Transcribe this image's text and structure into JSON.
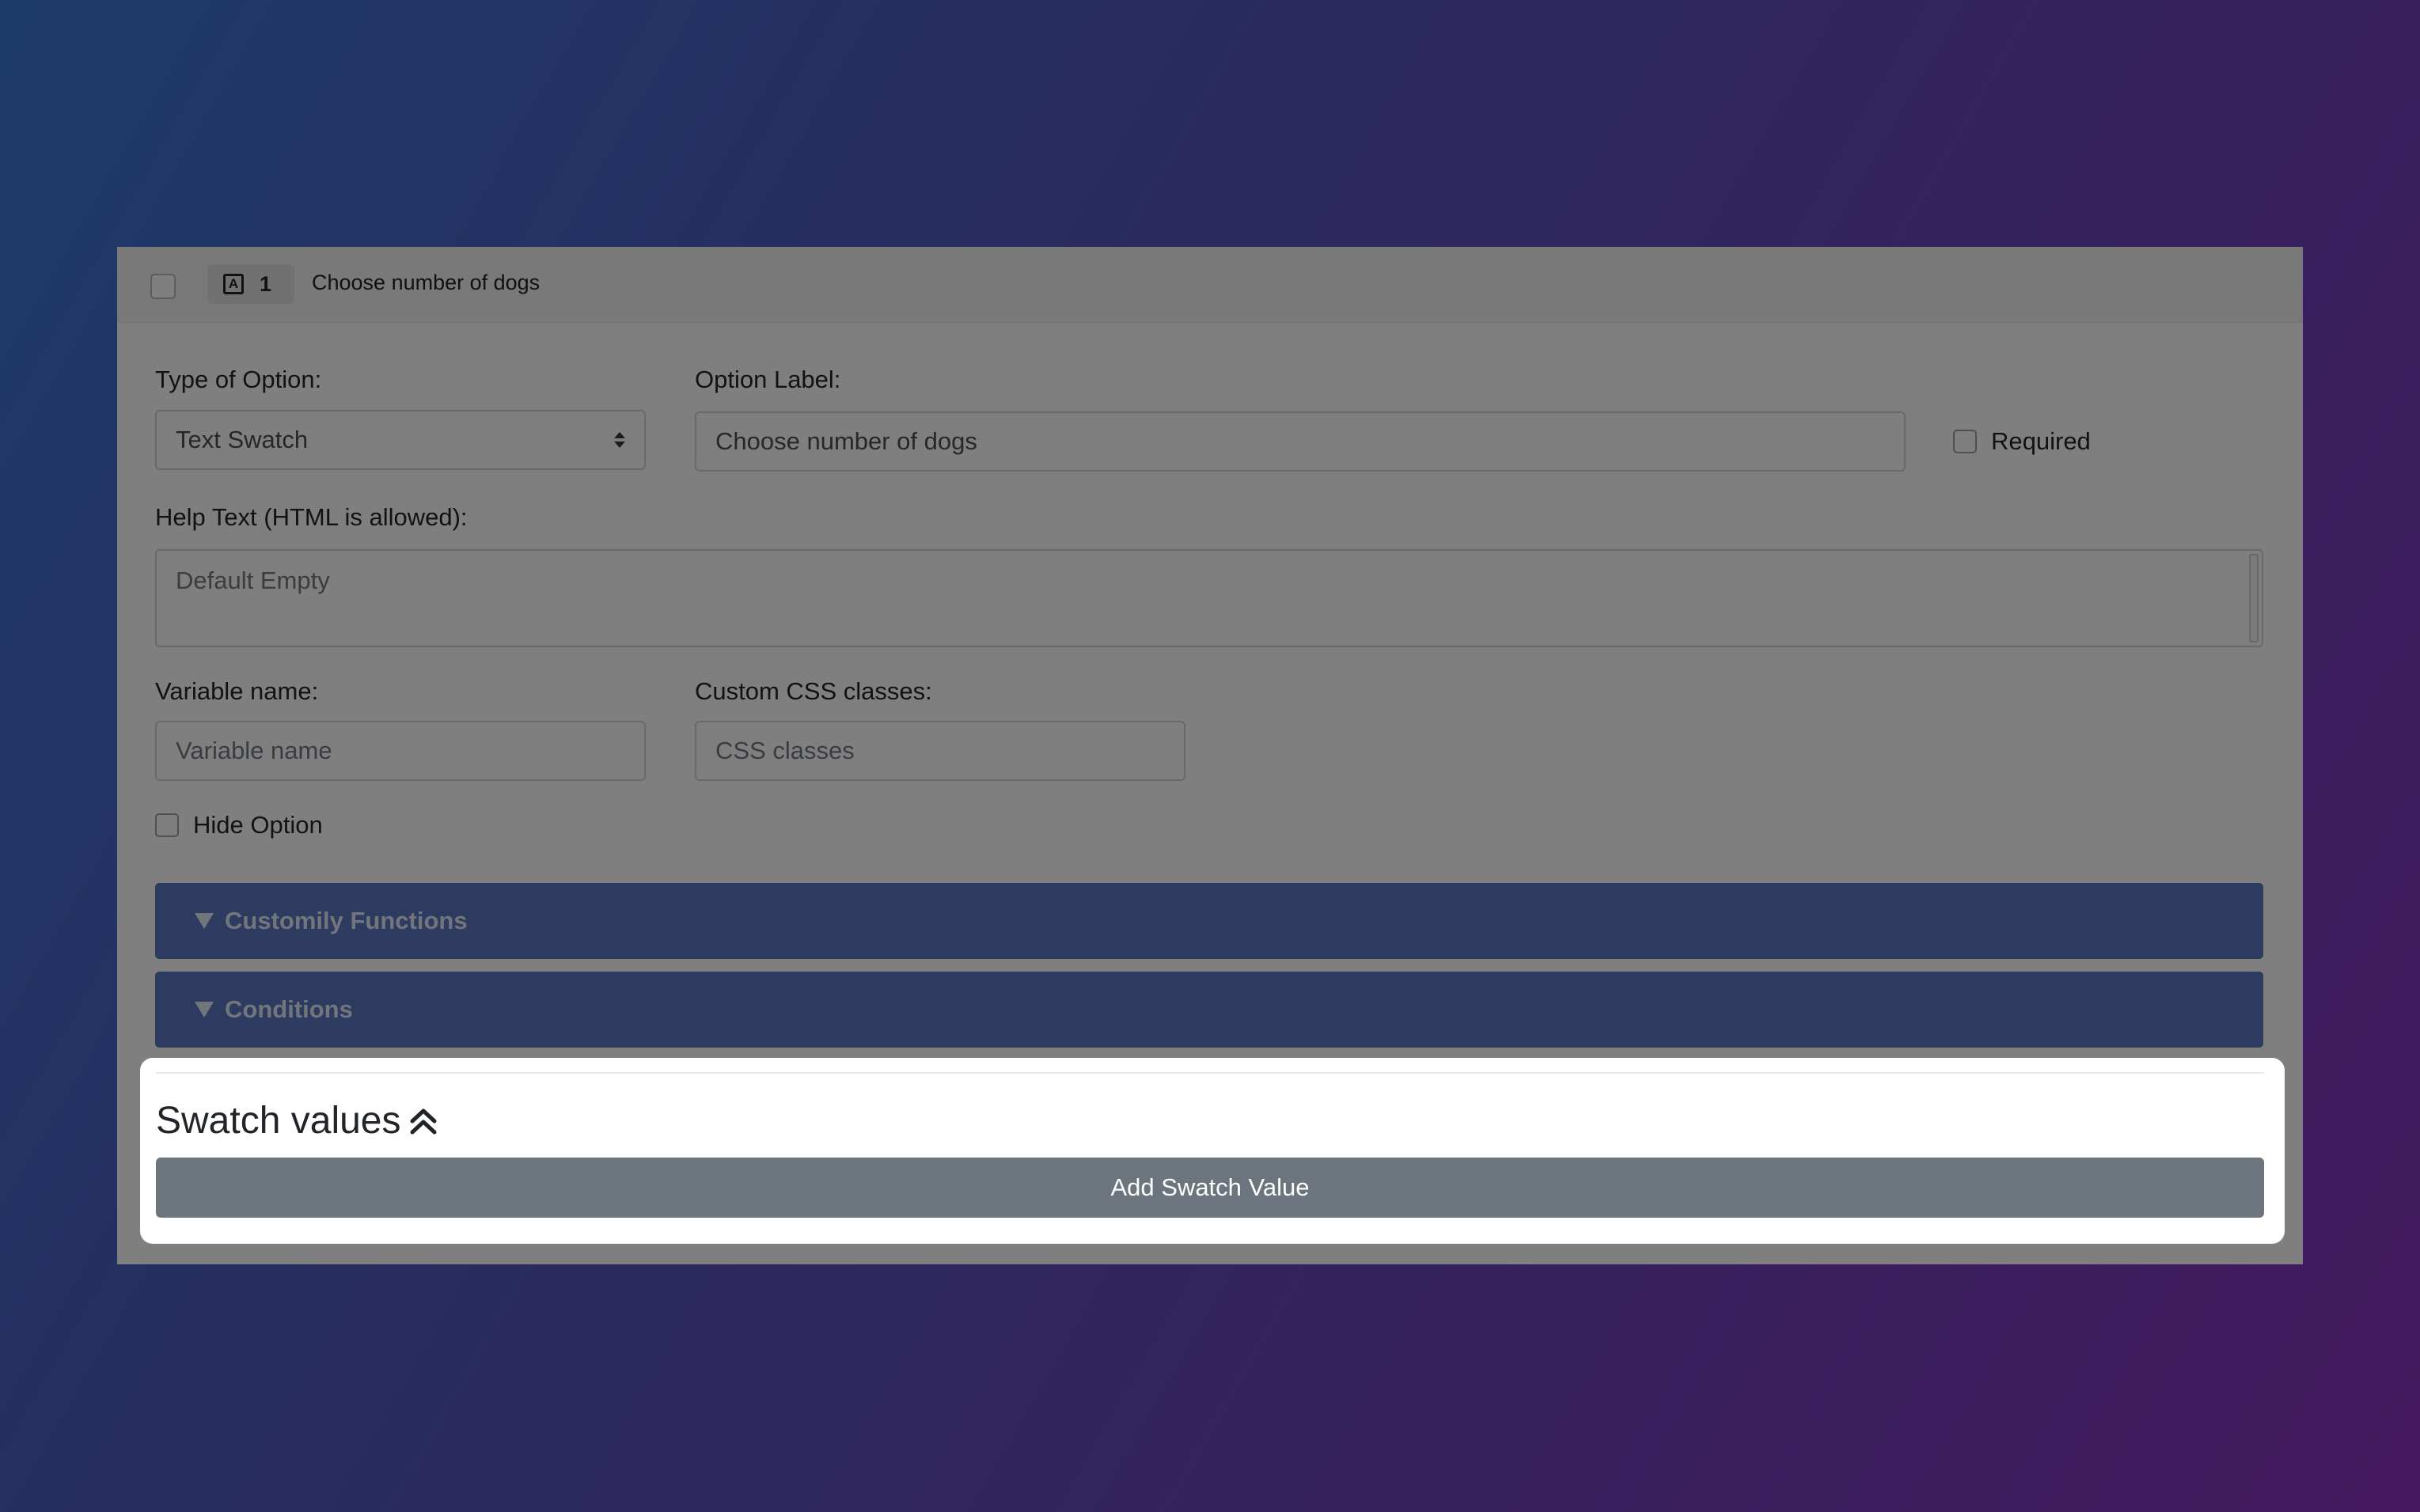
{
  "header": {
    "type_icon": "A",
    "number": "1",
    "title": "Choose number of dogs"
  },
  "form": {
    "type_label": "Type of Option:",
    "type_value": "Text Swatch",
    "option_label_label": "Option Label:",
    "option_label_value": "Choose number of dogs",
    "required_label": "Required",
    "help_label": "Help Text (HTML is allowed):",
    "help_placeholder": "Default Empty",
    "variable_label": "Variable name:",
    "variable_placeholder": "Variable name",
    "css_label": "Custom CSS classes:",
    "css_placeholder": "CSS classes",
    "hide_label": "Hide Option"
  },
  "accordions": {
    "functions": "Customily Functions",
    "conditions": "Conditions"
  },
  "swatch": {
    "title": "Swatch values",
    "add_button": "Add Swatch Value"
  },
  "colors": {
    "accordion": "#5a76c2",
    "button": "#6c757d"
  },
  "icons": [
    "type-text-icon",
    "chevron-double-up-icon",
    "caret-down-icon",
    "select-arrows-icon"
  ]
}
